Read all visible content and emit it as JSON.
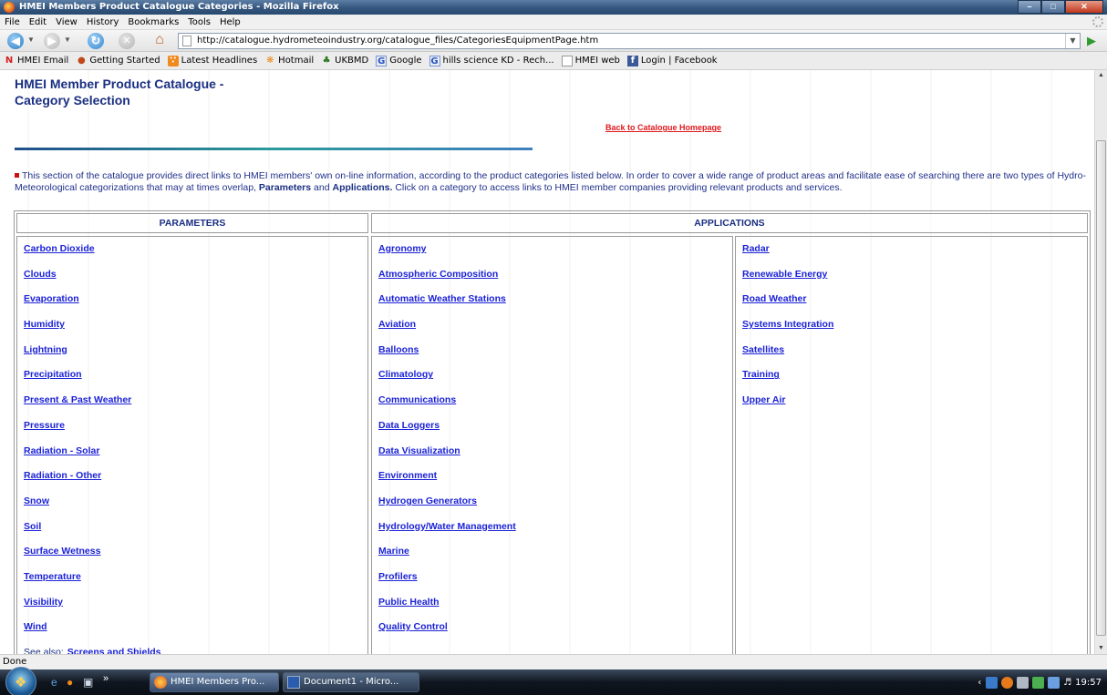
{
  "window": {
    "title": "HMEI Members Product Catalogue Categories - Mozilla Firefox"
  },
  "menu": [
    "File",
    "Edit",
    "View",
    "History",
    "Bookmarks",
    "Tools",
    "Help"
  ],
  "address": {
    "url": "http://catalogue.hydrometeoindustry.org/catalogue_files/CategoriesEquipmentPage.htm"
  },
  "bookmarks": [
    {
      "label": "HMEI Email",
      "icon": "n-icon"
    },
    {
      "label": "Getting Started",
      "icon": "firefox-icon"
    },
    {
      "label": "Latest Headlines",
      "icon": "rss-icon"
    },
    {
      "label": "Hotmail",
      "icon": "butterfly-icon"
    },
    {
      "label": "UKBMD",
      "icon": "tree-icon"
    },
    {
      "label": "Google",
      "icon": "google-icon"
    },
    {
      "label": "hills science KD - Rech...",
      "icon": "google-icon"
    },
    {
      "label": "HMEI web",
      "icon": "page-icon"
    },
    {
      "label": "Login | Facebook",
      "icon": "facebook-icon"
    }
  ],
  "page": {
    "title_line1": "HMEI Member Product Catalogue -",
    "title_line2": "Category Selection",
    "back_link": "Back to Catalogue Homepage",
    "intro_text": "This section of the catalogue provides direct links to HMEI members' own on-line information, according to the product categories listed below. In order to cover a wide range of product areas and facilitate ease of searching there are two types of Hydro-Meteorological categorizations that may at times overlap,",
    "intro_param": "Parameters",
    "intro_and": "and",
    "intro_app": "Applications.",
    "intro_tail": "Click on a category to access links to HMEI member companies providing relevant products and services.",
    "accent_colors": {
      "title": "#1a2f82",
      "link": "#1b22d6",
      "back_link": "#e0181d",
      "rule": "#2a9a9a"
    }
  },
  "table": {
    "param_header": "PARAMETERS",
    "app_header": "APPLICATIONS",
    "parameters": [
      "Carbon Dioxide",
      "Clouds",
      "Evaporation",
      "Humidity",
      "Lightning",
      "Precipitation",
      "Present & Past Weather",
      "Pressure",
      "Radiation - Solar",
      "Radiation - Other",
      "Snow",
      "Soil",
      "Surface Wetness",
      "Temperature",
      "Visibility",
      "Wind"
    ],
    "see_also_label": "See also:",
    "see_also_link": "Screens and Shields",
    "applications_col1": [
      "Agronomy",
      "Atmospheric Composition",
      "Automatic Weather Stations",
      "Aviation",
      "Balloons",
      "Climatology",
      "Communications",
      "Data Loggers",
      "Data Visualization",
      "Environment",
      "Hydrogen Generators",
      "Hydrology/Water Management",
      "Marine",
      "Profilers",
      "Public Health",
      "Quality Control"
    ],
    "applications_col2": [
      "Radar",
      "Renewable Energy",
      "Road Weather",
      "Systems Integration",
      "Satellites",
      "Training",
      "Upper Air"
    ]
  },
  "status": {
    "text": "Done"
  },
  "taskbar": {
    "tasks": [
      "HMEI Members Pro...",
      "Document1 - Micro..."
    ],
    "chevron": "»",
    "clock": "19:57"
  }
}
